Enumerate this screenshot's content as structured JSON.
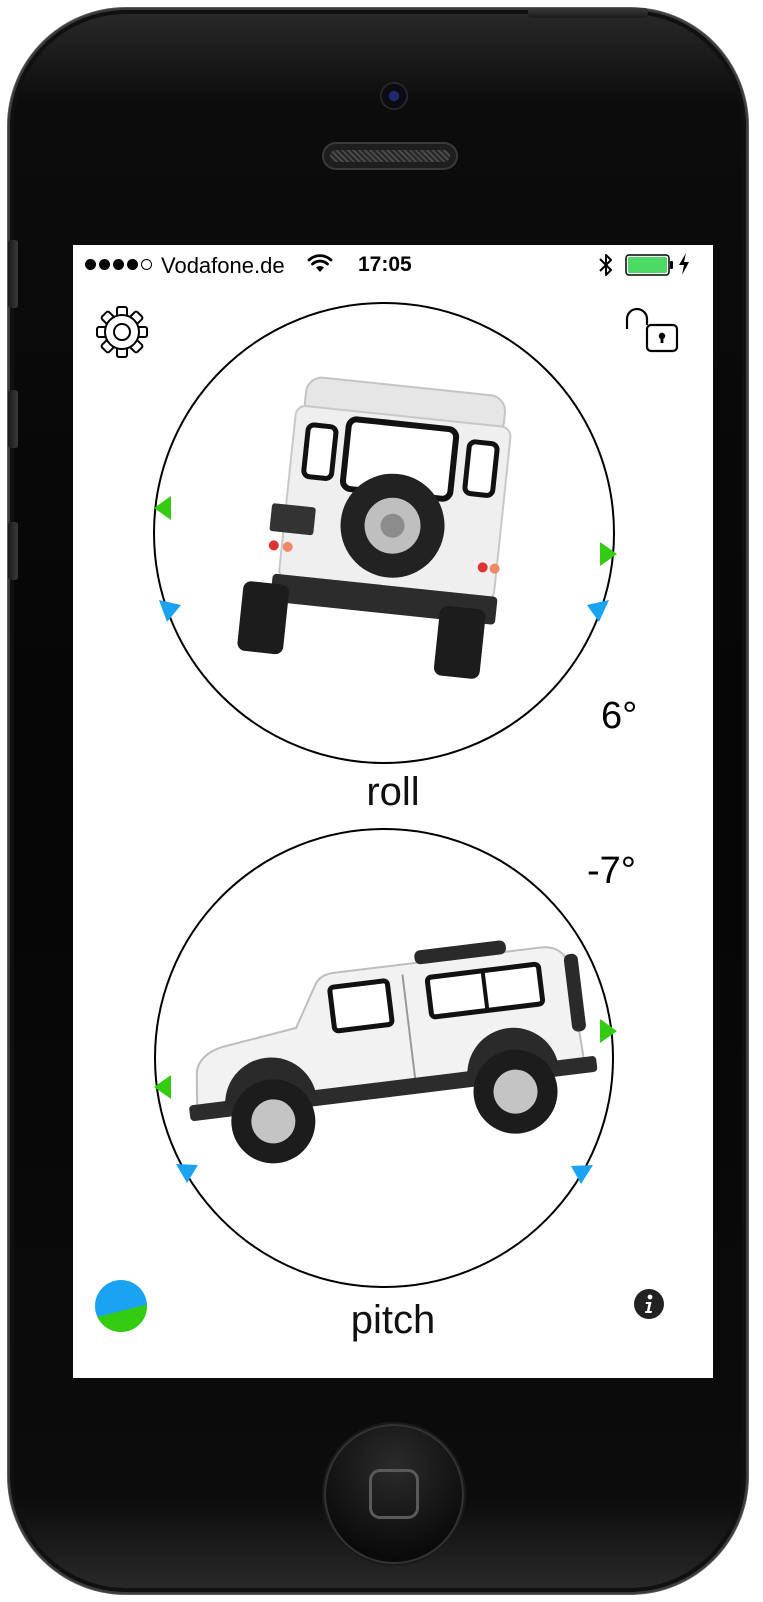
{
  "status_bar": {
    "signal_bars": 4,
    "carrier": "Vodafone.de",
    "time": "17:05",
    "battery_level": 1.0
  },
  "roll": {
    "label": "roll",
    "value": "6°",
    "vehicle_view": "rear"
  },
  "pitch": {
    "label": "pitch",
    "value": "-7°",
    "vehicle_view": "side"
  },
  "icons": {
    "settings": "gear-icon",
    "lock": "unlocked-padlock-icon",
    "info": "info-icon",
    "calibrate": "horizon-ball-icon"
  },
  "colors": {
    "marker_green": "#33cc11",
    "marker_blue": "#1aa3f2",
    "battery_green": "#4cd964",
    "phone_body": "#050505"
  }
}
